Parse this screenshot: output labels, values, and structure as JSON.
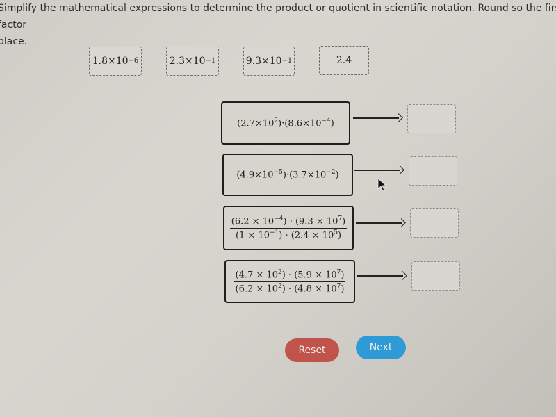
{
  "instructions": {
    "line1": "Simplify the mathematical expressions to determine the product or quotient in scientific notation. Round so the first factor",
    "line2": "place."
  },
  "tiles": [
    {
      "mantissa": "1.8",
      "times": "×10",
      "exp": "−6"
    },
    {
      "mantissa": "2.3",
      "times": "×10",
      "exp": "−1"
    },
    {
      "mantissa": "9.3",
      "times": "×10",
      "exp": "−1"
    },
    {
      "plain": "2.4"
    }
  ],
  "expressions": [
    {
      "type": "product",
      "f1": {
        "open": "(2.7×10",
        "exp": "2",
        "close": ")"
      },
      "dot": "·",
      "f2": {
        "open": "(8.6×10",
        "exp": "−4",
        "close": ")"
      }
    },
    {
      "type": "product",
      "f1": {
        "open": "(4.9×10",
        "exp": "−5",
        "close": ")"
      },
      "dot": "·",
      "f2": {
        "open": "(3.7×10",
        "exp": "−2",
        "close": ")"
      }
    },
    {
      "type": "quotient",
      "num": {
        "f1": {
          "open": "(6.2 × 10",
          "exp": "−4",
          "close": ")"
        },
        "dot": " · ",
        "f2": {
          "open": "(9.3 × 10",
          "exp": "7",
          "close": ")"
        }
      },
      "den": {
        "f1": {
          "open": "(1 × 10",
          "exp": "−1",
          "close": ")"
        },
        "dot": " · ",
        "f2": {
          "open": "(2.4 × 10",
          "exp": "5",
          "close": ")"
        }
      }
    },
    {
      "type": "quotient",
      "num": {
        "f1": {
          "open": "(4.7 × 10",
          "exp": "2",
          "close": ")"
        },
        "dot": " · ",
        "f2": {
          "open": "(5.9 × 10",
          "exp": "7",
          "close": ")"
        }
      },
      "den": {
        "f1": {
          "open": "(6.2 × 10",
          "exp": "2",
          "close": ")"
        },
        "dot": " · ",
        "f2": {
          "open": "(4.8 × 10",
          "exp": "7",
          "close": ")"
        }
      }
    }
  ],
  "drop_targets": [
    "",
    "",
    "",
    ""
  ],
  "buttons": {
    "reset": {
      "label": "Reset",
      "color": "#c0544a"
    },
    "next": {
      "label": "Next",
      "color": "#2e9bd6"
    }
  }
}
